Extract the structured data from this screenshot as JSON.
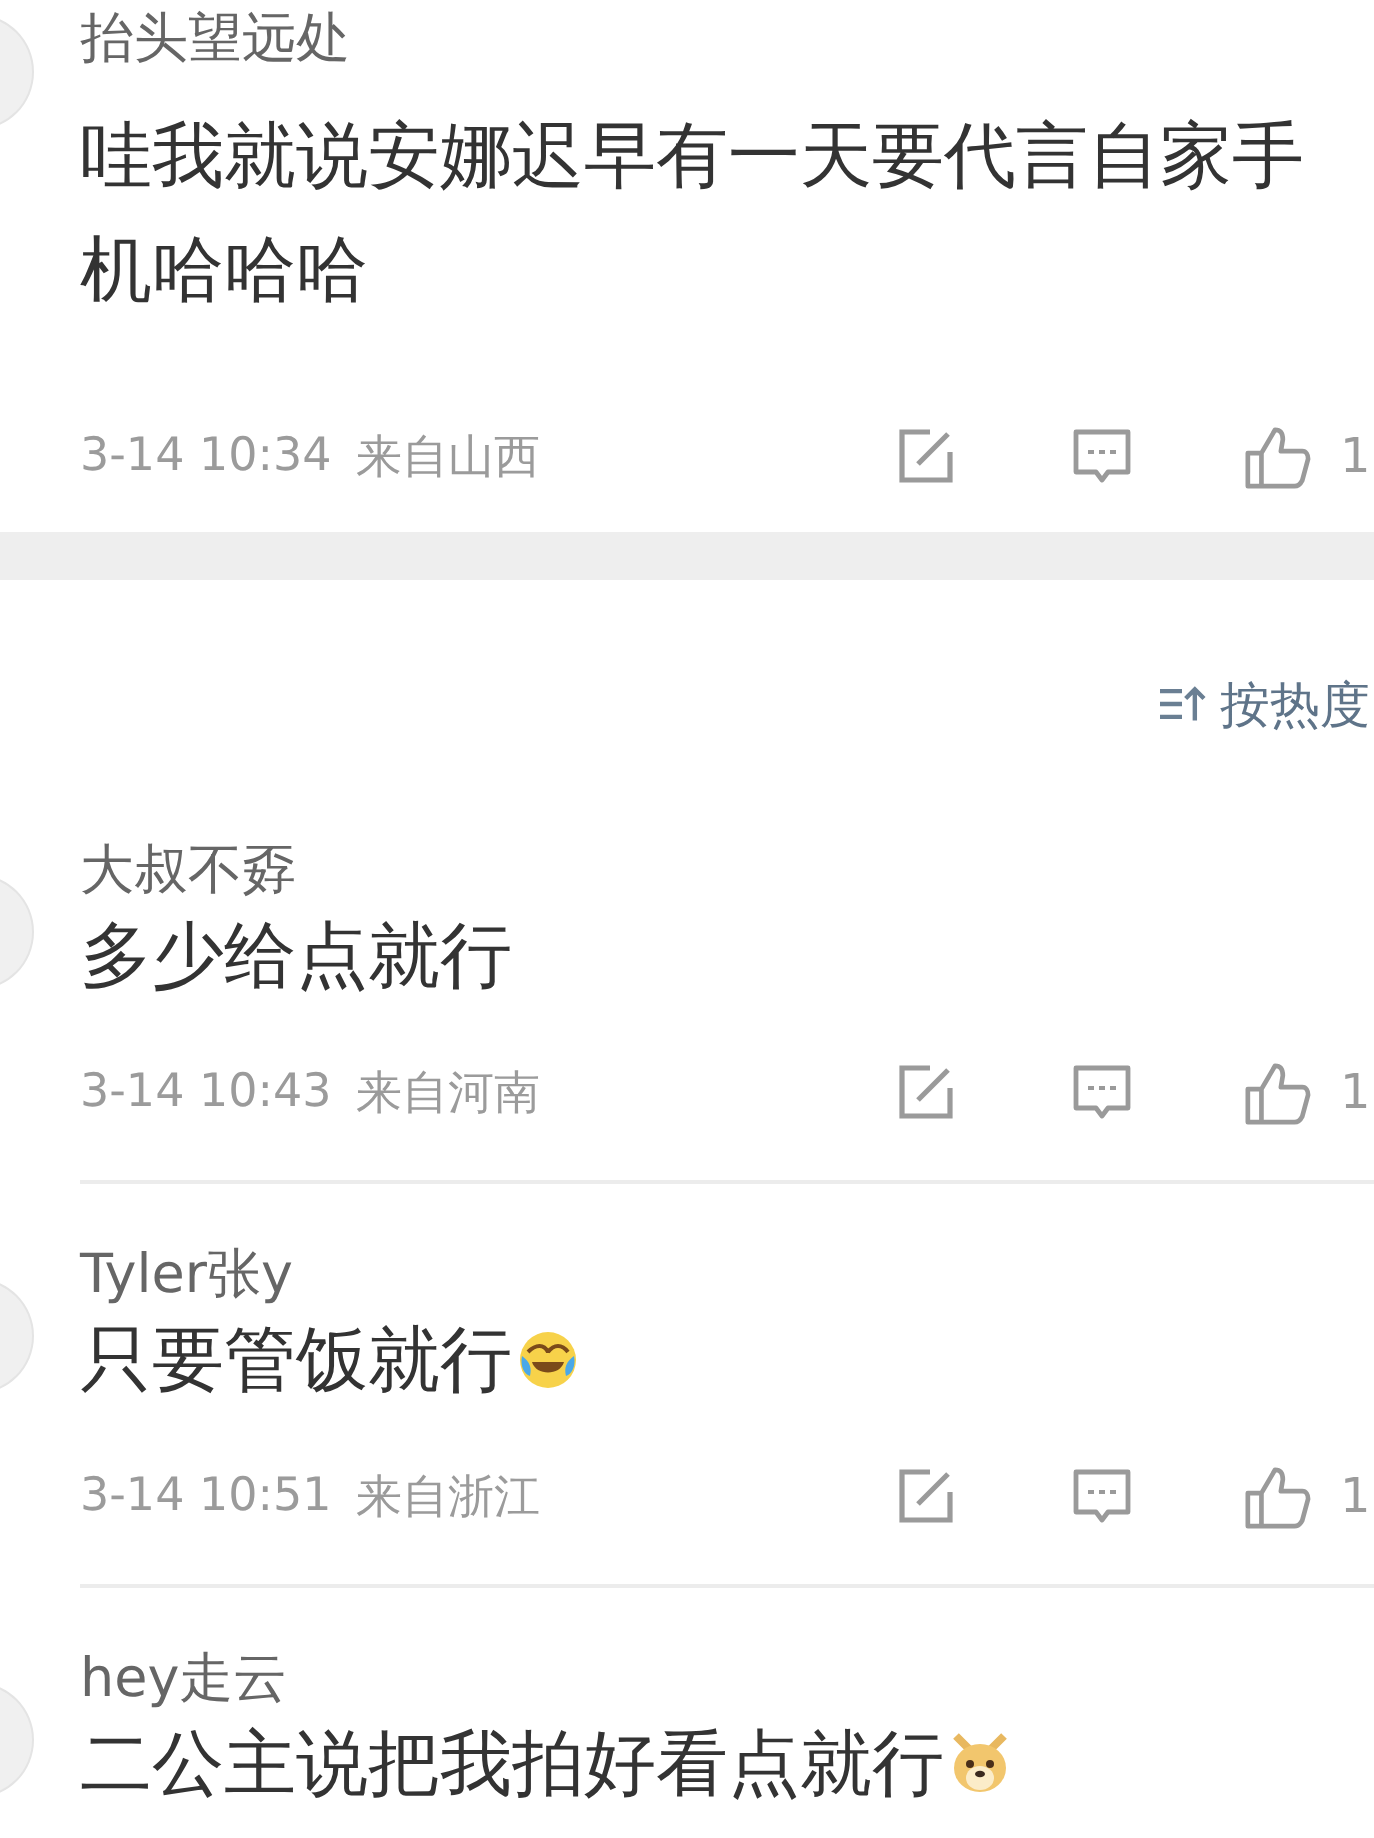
{
  "top_comment": {
    "name": "抬头望远处",
    "text": "哇我就说安娜迟早有一天要代言自家手机哈哈哈",
    "time": "3-14 10:34",
    "location": "来自山西",
    "likes": "1"
  },
  "sort": {
    "label": "按热度"
  },
  "comments": [
    {
      "name": "大叔不孬",
      "text": "多少给点就行",
      "time": "3-14 10:43",
      "location": "来自河南",
      "likes": "1"
    },
    {
      "name": "Tyler张y",
      "text": "只要管饭就行",
      "emoji": {
        "kind": "laughing"
      },
      "time": "3-14 10:51",
      "location": "来自浙江",
      "likes": "1"
    },
    {
      "name": "hey走云",
      "text": "二公主说把我拍好看点就行",
      "emoji": {
        "kind": "dog"
      }
    }
  ]
}
